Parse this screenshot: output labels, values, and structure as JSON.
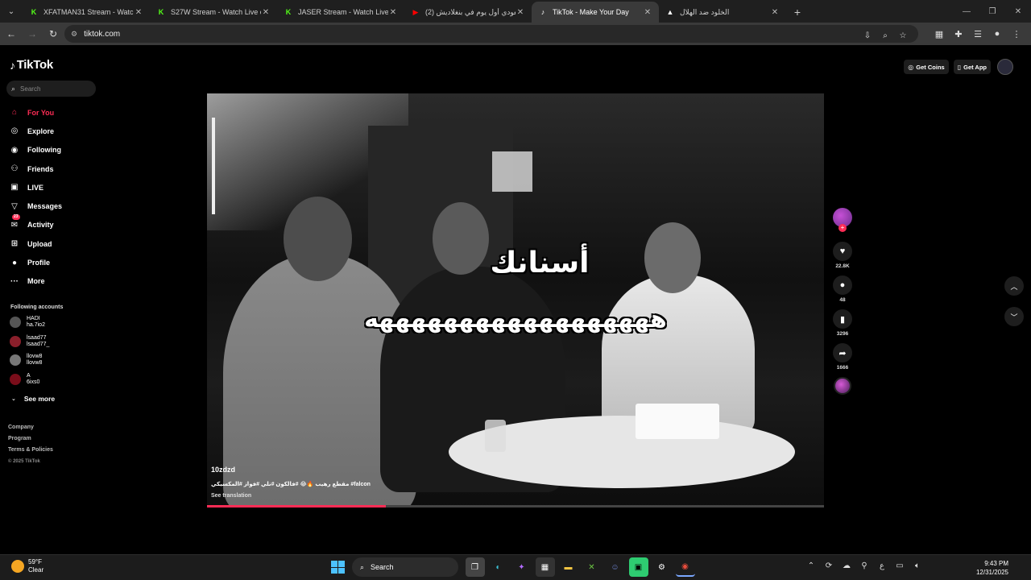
{
  "browser": {
    "tabs": [
      {
        "title": "XFATMAN31 Stream - Watch Li",
        "favicon": "K",
        "favicon_color": "#53fc18",
        "active": false
      },
      {
        "title": "S27W Stream - Watch Live on K",
        "favicon": "K",
        "favicon_color": "#53fc18",
        "active": false
      },
      {
        "title": "JASER Stream - Watch Live on K",
        "favicon": "K",
        "favicon_color": "#53fc18",
        "active": false
      },
      {
        "title": "(2) سعودي أول يوم في بنغلاديش",
        "favicon": "▶",
        "favicon_color": "#ff0000",
        "active": false
      },
      {
        "title": "TikTok - Make Your Day",
        "favicon": "♪",
        "favicon_color": "#ffffff",
        "active": true
      },
      {
        "title": "الخلود ضد الهلال",
        "favicon": "▲",
        "favicon_color": "#ffffff",
        "active": false
      }
    ],
    "url": "tiktok.com",
    "new_tab_icon": "plus-icon"
  },
  "tiktok": {
    "logo": "TikTok",
    "search_placeholder": "Search",
    "nav": [
      {
        "label": "For You",
        "icon": "home-icon",
        "glyph": "⌂",
        "active": true
      },
      {
        "label": "Explore",
        "icon": "compass-icon",
        "glyph": "◎",
        "active": false
      },
      {
        "label": "Following",
        "icon": "following-icon",
        "glyph": "◉",
        "active": false
      },
      {
        "label": "Friends",
        "icon": "friends-icon",
        "glyph": "⚇",
        "active": false
      },
      {
        "label": "LIVE",
        "icon": "live-icon",
        "glyph": "▣",
        "active": false
      },
      {
        "label": "Messages",
        "icon": "messages-icon",
        "glyph": "▽",
        "active": false
      },
      {
        "label": "Activity",
        "icon": "activity-icon",
        "glyph": "✉",
        "active": false,
        "badge": "23"
      },
      {
        "label": "Upload",
        "icon": "upload-icon",
        "glyph": "⊞",
        "active": false
      },
      {
        "label": "Profile",
        "icon": "profile-icon",
        "glyph": "●",
        "active": false
      },
      {
        "label": "More",
        "icon": "more-icon",
        "glyph": "···",
        "active": false
      }
    ],
    "following_title": "Following accounts",
    "following_accounts": [
      {
        "name": "HADI",
        "handle": "ha.7io2"
      },
      {
        "name": "lsaad77",
        "handle": "lsaad77_"
      },
      {
        "name": "llovw8",
        "handle": "llovw8"
      },
      {
        "name": "A",
        "handle": "6ixs0"
      }
    ],
    "see_more": "See more",
    "footer": [
      "Company",
      "Program",
      "Terms & Policies",
      "© 2025 TikTok"
    ],
    "top_right": {
      "coins": "Get Coins",
      "app": "Get App"
    },
    "video": {
      "caption_line1": "أسنانك",
      "caption_line2": "ههههههههههههههههههه",
      "author": "10zdzd",
      "description": "مقطع رهيب 🔥😂 #فالكون #نلي #فواز #المكسيكي #falcon",
      "see_translation": "See translation",
      "progress": 0.29
    },
    "actions": {
      "likes": "22.8K",
      "comments": "48",
      "saves": "3296",
      "shares": "1666"
    }
  },
  "taskbar": {
    "temp": "59°F",
    "condition": "Clear",
    "search": "Search",
    "time": "9:43 PM",
    "date": "12/31/2025",
    "lang": "ع"
  }
}
